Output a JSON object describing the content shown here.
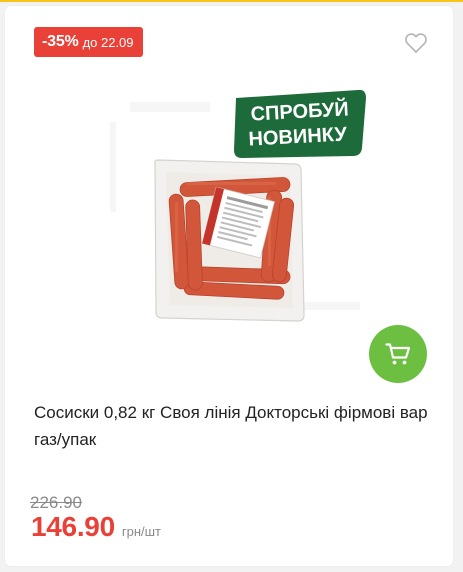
{
  "discount": {
    "percent": "-35%",
    "until": "до 22.09"
  },
  "new_badge": {
    "line1": "СПРОБУЙ",
    "line2": "НОВИНКУ"
  },
  "product": {
    "title": "Сосиски 0,82 кг Своя лінія Докторські фірмові вар газ/упак",
    "image": "sausages-pack-image"
  },
  "pricing": {
    "old_price": "226.90",
    "price": "146.90",
    "unit": "грн/шт"
  },
  "icons": {
    "wishlist": "heart-outline-icon",
    "cart": "cart-icon"
  },
  "colors": {
    "discount_red": "#e94038",
    "cart_green": "#6cbf41",
    "new_badge_green": "#1d6b3a",
    "top_strip_yellow": "#f5c518"
  }
}
